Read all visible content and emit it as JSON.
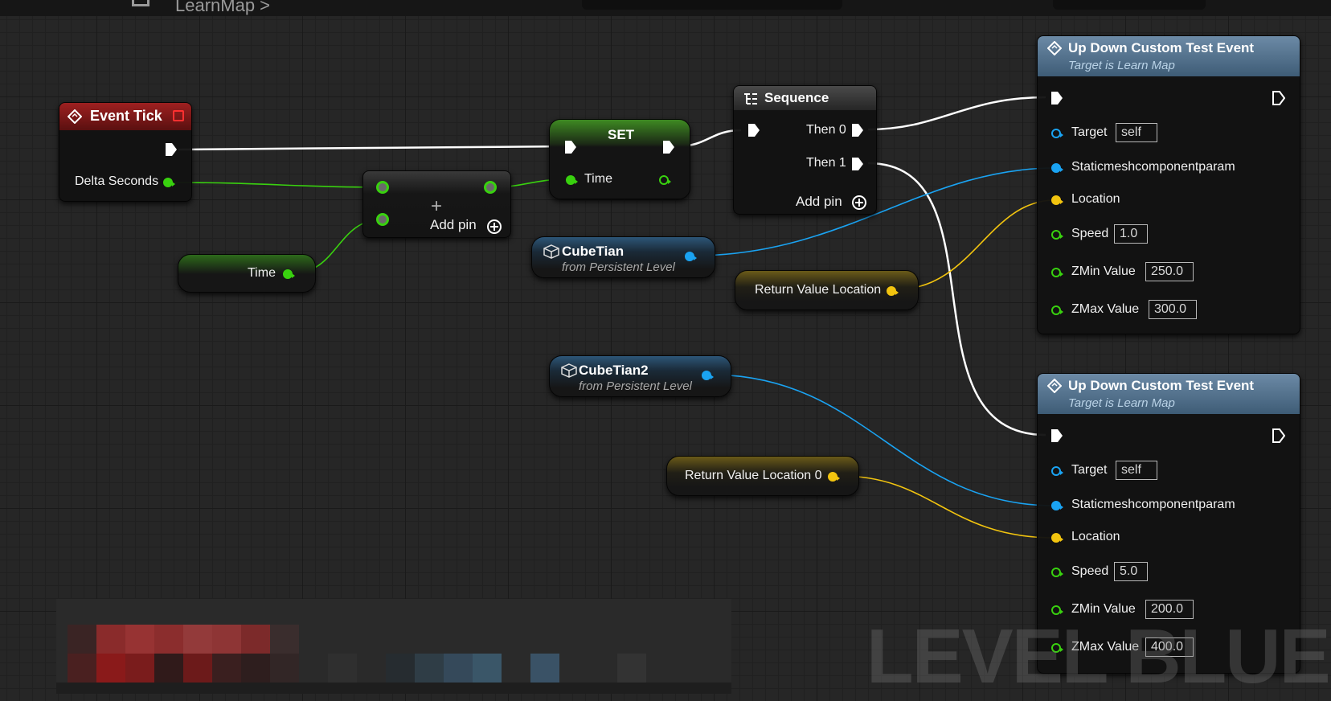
{
  "toolbar": {
    "breadcrumb": "LearnMap >"
  },
  "nodes": {
    "event_tick": {
      "title": "Event Tick",
      "delta_seconds": "Delta Seconds"
    },
    "add": {
      "add_pin": "Add pin"
    },
    "time_getter": {
      "label": "Time"
    },
    "set": {
      "title": "SET",
      "time": "Time"
    },
    "sequence": {
      "title": "Sequence",
      "then0": "Then 0",
      "then1": "Then 1",
      "add_pin": "Add pin"
    },
    "cube1": {
      "title": "CubeTian",
      "subtitle": "from Persistent Level"
    },
    "cube2": {
      "title": "CubeTian2",
      "subtitle": "from Persistent Level"
    },
    "retloc": {
      "label": "Return Value Location"
    },
    "retloc0": {
      "label": "Return Value Location 0"
    },
    "event1": {
      "title": "Up Down Custom Test Event",
      "subtitle": "Target is Learn Map",
      "target": "Target",
      "target_val": "self",
      "mesh": "Staticmeshcomponentparam",
      "location": "Location",
      "speed": "Speed",
      "speed_val": "1.0",
      "zmin": "ZMin Value",
      "zmin_val": "250.0",
      "zmax": "ZMax Value",
      "zmax_val": "300.0"
    },
    "event2": {
      "title": "Up Down Custom Test Event",
      "subtitle": "Target is Learn Map",
      "target": "Target",
      "target_val": "self",
      "mesh": "Staticmeshcomponentparam",
      "location": "Location",
      "speed": "Speed",
      "speed_val": "5.0",
      "zmin": "ZMin Value",
      "zmin_val": "200.0",
      "zmax": "ZMax Value",
      "zmax_val": "400.0"
    }
  },
  "watermark": "LEVEL BLUEPRINT",
  "colors": {
    "exec": "#ffffff",
    "float": "#39d10f",
    "object": "#1aa3f2",
    "vector": "#f2c40f",
    "event_header": "#8a1a1a",
    "call_header": "#4a6f8f"
  }
}
